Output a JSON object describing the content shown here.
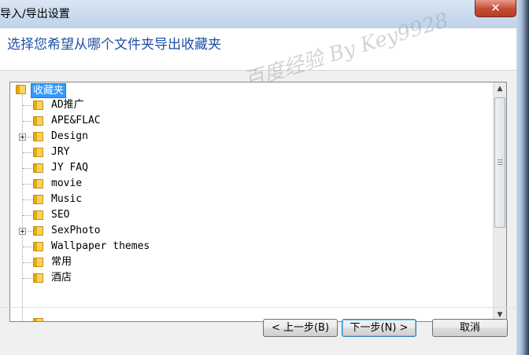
{
  "window": {
    "title": "导入/导出设置",
    "close_glyph": "✕"
  },
  "header": {
    "instruction": "选择您希望从哪个文件夹导出收藏夹"
  },
  "watermark": {
    "text": "百度经验 By Key9928"
  },
  "tree": {
    "root": {
      "label": "收藏夹",
      "icon": "folder-icon",
      "selected": true
    },
    "items": [
      {
        "label": "AD推广",
        "icon": "folder-icon",
        "expandable": false
      },
      {
        "label": "APE&FLAC",
        "icon": "folder-icon",
        "expandable": false
      },
      {
        "label": "Design",
        "icon": "folder-icon",
        "expandable": true
      },
      {
        "label": "JRY",
        "icon": "folder-icon",
        "expandable": false
      },
      {
        "label": "JY FAQ",
        "icon": "folder-icon",
        "expandable": false
      },
      {
        "label": "movie",
        "icon": "folder-icon",
        "expandable": false
      },
      {
        "label": "Music",
        "icon": "folder-icon",
        "expandable": false
      },
      {
        "label": "SEO",
        "icon": "folder-icon",
        "expandable": false
      },
      {
        "label": "SexPhoto",
        "icon": "folder-icon",
        "expandable": true
      },
      {
        "label": "Wallpaper themes",
        "icon": "folder-icon",
        "expandable": false
      },
      {
        "label": "常用",
        "icon": "folder-icon",
        "expandable": false
      },
      {
        "label": "酒店",
        "icon": "folder-icon",
        "expandable": false
      }
    ],
    "scrollbar": {
      "up_glyph": "▲",
      "down_glyph": "▼"
    }
  },
  "footer": {
    "back_label": "< 上一步(B)",
    "next_label": "下一步(N) >",
    "cancel_label": "取消"
  },
  "colors": {
    "instruction_text": "#1e4fa8",
    "selection": "#3399ff",
    "close_button": "#c54a33"
  }
}
